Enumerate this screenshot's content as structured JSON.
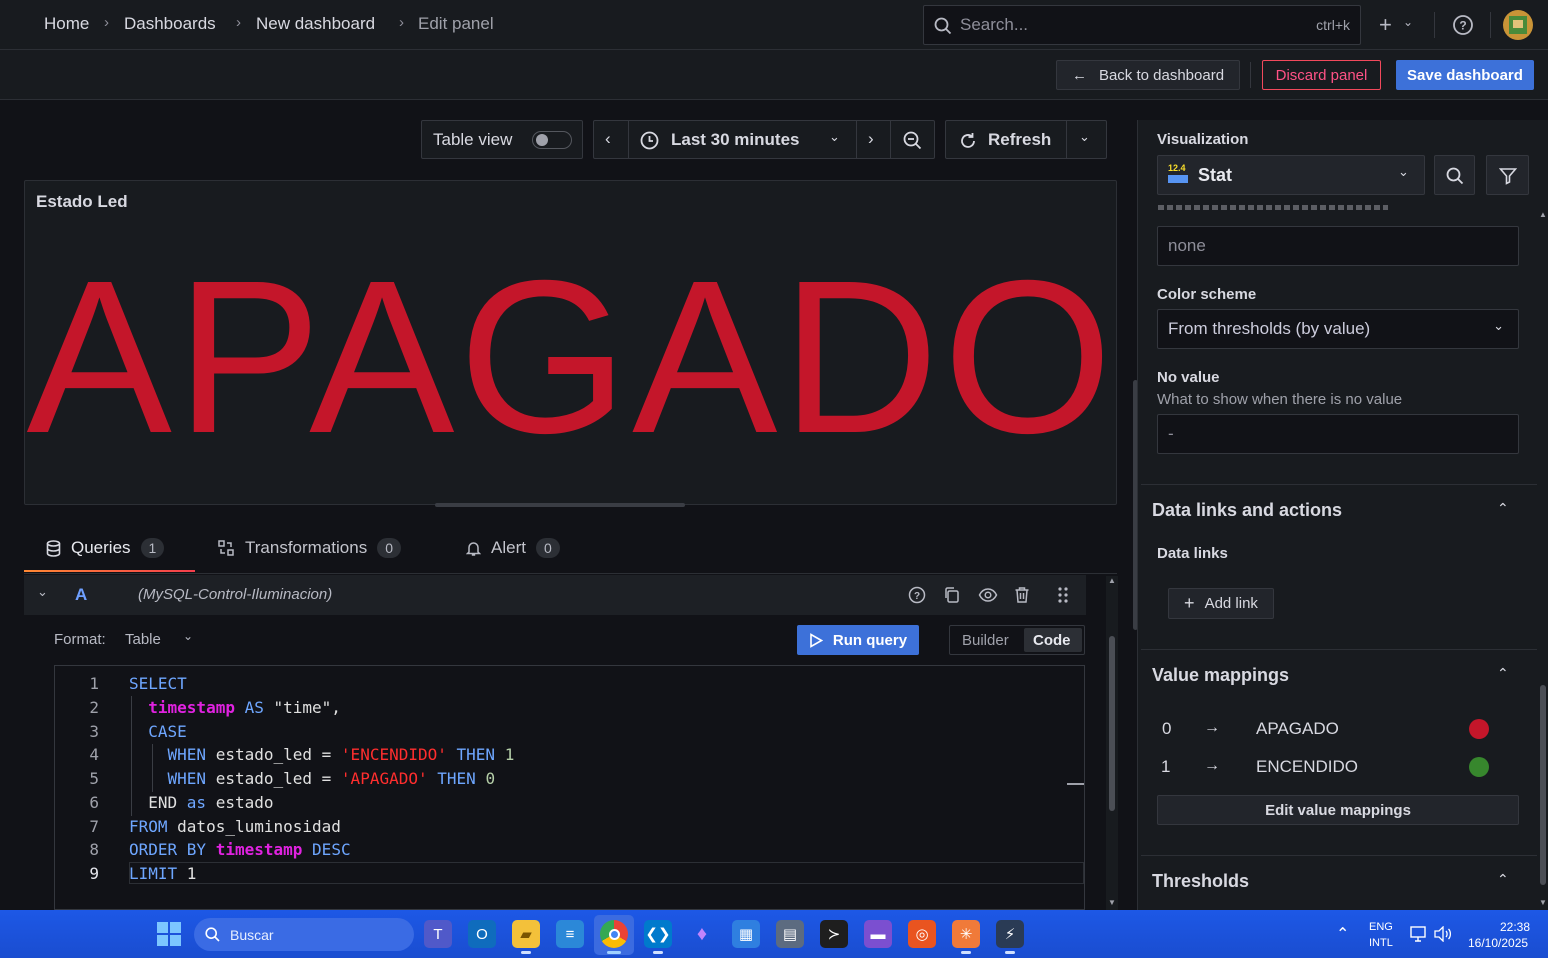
{
  "breadcrumb": [
    "Home",
    "Dashboards",
    "New dashboard",
    "Edit panel"
  ],
  "search": {
    "placeholder": "Search...",
    "shortcut": "ctrl+k"
  },
  "toolbar": {
    "back_label": "Back to dashboard",
    "discard_label": "Discard panel",
    "save_label": "Save dashboard"
  },
  "panel_controls": {
    "table_view_label": "Table view",
    "time_range": "Last 30 minutes",
    "refresh_label": "Refresh"
  },
  "panel": {
    "title": "Estado Led",
    "value": "APAGADO",
    "value_color": "#c4162a"
  },
  "tabs": [
    {
      "label": "Queries",
      "count": "1"
    },
    {
      "label": "Transformations",
      "count": "0"
    },
    {
      "label": "Alert",
      "count": "0"
    }
  ],
  "query": {
    "ref": "A",
    "datasource": "(MySQL-Control-Iluminacion)",
    "format_label": "Format:",
    "format_value": "Table",
    "run_label": "Run query",
    "mode_builder": "Builder",
    "mode_code": "Code",
    "line_numbers": [
      "1",
      "2",
      "3",
      "4",
      "5",
      "6",
      "7",
      "8",
      "9"
    ]
  },
  "options": {
    "visualization_label": "Visualization",
    "visualization_value": "Stat",
    "visualization_badge": "12.4",
    "display_name_value": "none",
    "color_scheme_label": "Color scheme",
    "color_scheme_value": "From thresholds (by value)",
    "no_value_label": "No value",
    "no_value_desc": "What to show when there is no value",
    "no_value_value": "-",
    "data_links_section": "Data links and actions",
    "data_links_label": "Data links",
    "add_link_label": "Add link",
    "value_mappings_section": "Value mappings",
    "mappings": [
      {
        "from": "0",
        "to": "APAGADO",
        "color": "#c4162a"
      },
      {
        "from": "1",
        "to": "ENCENDIDO",
        "color": "#37872d"
      }
    ],
    "edit_mappings_label": "Edit value mappings",
    "thresholds_section": "Thresholds"
  },
  "taskbar": {
    "search_placeholder": "Buscar",
    "lang_top": "ENG",
    "lang_bottom": "INTL",
    "time": "22:38",
    "date": "16/10/2025"
  },
  "colors": {
    "primary": "#3d71d9",
    "danger": "#f2495c",
    "bg": "#111217",
    "panel": "#181b1f"
  }
}
